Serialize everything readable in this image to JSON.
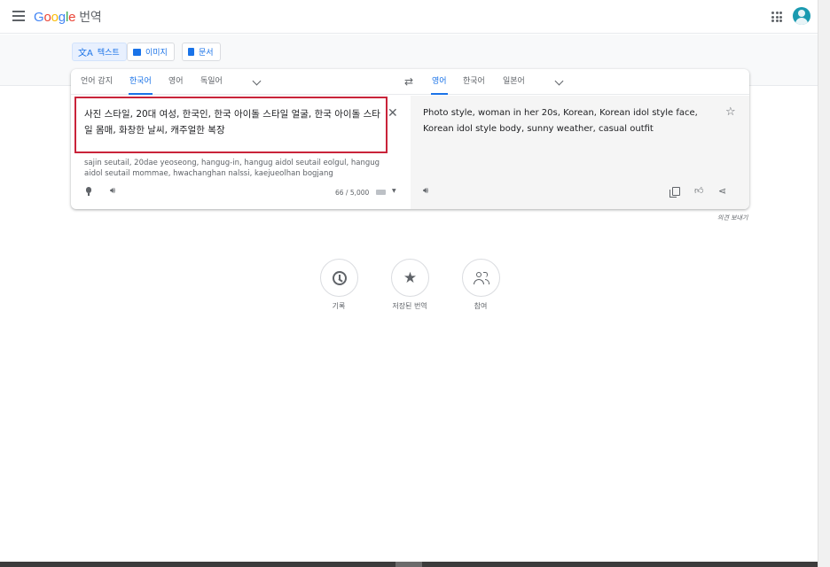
{
  "header": {
    "logo": [
      "G",
      "o",
      "o",
      "g",
      "l",
      "e"
    ],
    "product": "번역"
  },
  "modes": [
    {
      "label": "텍스트",
      "icon": "translate-icon"
    },
    {
      "label": "이미지",
      "icon": "image-icon"
    },
    {
      "label": "문서",
      "icon": "document-icon"
    }
  ],
  "source_langs": [
    "언어 감지",
    "한국어",
    "영어",
    "독일어"
  ],
  "source_active": "한국어",
  "target_langs": [
    "영어",
    "한국어",
    "일본어"
  ],
  "target_active": "영어",
  "source": {
    "text": "사진 스타일, 20대 여성, 한국인, 한국 아이돌 스타일 얼굴, 한국 아이돌 스타일 몸매, 화창한 날씨, 캐주얼한 복장",
    "romanization": "sajin seutail, 20dae yeoseong, hangug-in, hangug aidol seutail eolgul, hangug aidol seutail mommae, hwachanghan nalssi, kaejueolhan bogjang",
    "char_count": "66 / 5,000"
  },
  "target": {
    "text": "Photo style, woman in her 20s, Korean, Korean idol style face, Korean idol style body, sunny weather, casual outfit"
  },
  "send_feedback": "의견 보내기",
  "bottom_actions": [
    {
      "label": "기록"
    },
    {
      "label": "저장된 번역"
    },
    {
      "label": "참여"
    }
  ],
  "colors": {
    "accent": "#1a73e8",
    "highlight_box": "#c9243a"
  }
}
